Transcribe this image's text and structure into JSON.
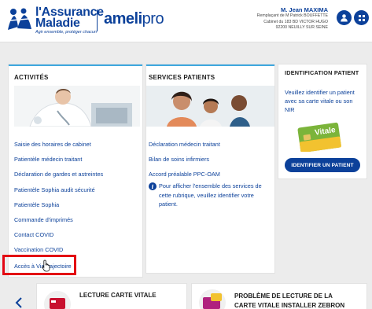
{
  "header": {
    "logo_title_line1": "l'Assurance",
    "logo_title_line2": "Maladie",
    "logo_tagline": "Agir ensemble, protéger chacun",
    "brand": "ameli",
    "brand_suffix": "pro",
    "user_name": "M. Jean MAXIMA",
    "user_line1": "Remplaçant de M Patrick BOUFFETTE",
    "user_line2": "Cabinet du 183 BD VICTOR HUGO",
    "user_line3": "92200 NEUILLY SUR SEINE",
    "profile_icon": "user-icon",
    "menu_icon": "grid-icon"
  },
  "activities": {
    "title": "ACTIVITÉS",
    "links": [
      "Saisie des horaires de cabinet",
      "Patientèle médecin traitant",
      "Déclaration de gardes et astreintes",
      "Patientèle Sophia audit sécurité",
      "Patientèle Sophia",
      "Commande d'imprimés",
      "Contact COVID",
      "Vaccination COVID",
      "Accès à ViaTrajectoire"
    ]
  },
  "patient_services": {
    "title": "SERVICES PATIENTS",
    "links": [
      "Déclaration médecin traitant",
      "Bilan de soins infirmiers",
      "Accord préalable PPC-OAM"
    ],
    "info_icon": "info-icon",
    "info_lines": [
      "Pour afficher l'ensemble des services de",
      "cette rubrique, veuillez identifier votre",
      "patient."
    ]
  },
  "patient_id": {
    "title": "IDENTIFICATION PATIENT",
    "text_lines": [
      "Veuillez identifier un patient",
      "avec sa carte vitale ou son",
      "NIR"
    ],
    "card_label": "Vitale",
    "button": "IDENTIFIER UN PATIENT"
  },
  "bottom": {
    "card1_title": "LECTURE CARTE VITALE",
    "card2_title_line1": "PROBLÈME DE LECTURE DE LA",
    "card2_title_line2": "CARTE VITALE INSTALLER ZEBRON"
  },
  "colors": {
    "brand_blue": "#0c419a",
    "accent_cyan": "#3ea7de",
    "highlight_red": "#e30613"
  }
}
